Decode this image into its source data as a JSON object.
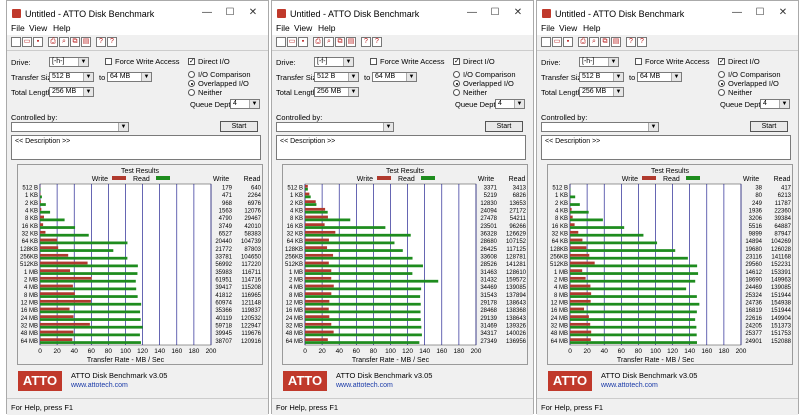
{
  "windows": [
    {
      "title": "Untitled - ATTO Disk Benchmark",
      "drive": "[-h-]",
      "ts_from": "512 B",
      "ts_to": "64 MB",
      "total_length": "256 MB",
      "queue_depth": "4",
      "write": [
        179,
        471,
        968,
        1563,
        4790,
        3749,
        6527,
        20440,
        21772,
        33781,
        56992,
        35983,
        61951,
        39417,
        41812,
        60974,
        35366,
        40119,
        59718,
        39945,
        38707
      ],
      "read": [
        640,
        2264,
        6976,
        12076,
        29467,
        42010,
        58383,
        104739,
        87803,
        104650,
        117220,
        116711,
        114716,
        115208,
        116965,
        121148,
        119837,
        120532,
        122947,
        119676,
        120916
      ]
    },
    {
      "title": "Untitled - ATTO Disk Benchmark",
      "drive": "[-f-]",
      "ts_from": "512 B",
      "ts_to": "64 MB",
      "total_length": "256 MB",
      "queue_depth": "4",
      "write": [
        3371,
        5219,
        12830,
        24094,
        27478,
        23501,
        36328,
        28680,
        26425,
        33608,
        28526,
        31463,
        31432,
        34469,
        31543,
        29178,
        28468,
        29139,
        31469,
        34317,
        27349
      ],
      "read": [
        3413,
        6826,
        13653,
        27172,
        54211,
        96266,
        126629,
        107152,
        117125,
        128781,
        141281,
        128610,
        159572,
        139085,
        137894,
        138643,
        138368,
        138643,
        139326,
        140026,
        136956
      ]
    },
    {
      "title": "Untitled - ATTO Disk Benchmark",
      "drive": "[-h-]",
      "ts_from": "512 B",
      "ts_to": "64 MB",
      "total_length": "256 MB",
      "queue_depth": "4",
      "write": [
        38,
        80,
        249,
        1936,
        3206,
        5516,
        9899,
        14894,
        19680,
        23116,
        29560,
        14612,
        18690,
        24469,
        25324,
        24736,
        16819,
        22616,
        24205,
        25377,
        24901
      ],
      "read": [
        417,
        6213,
        11787,
        22360,
        39384,
        64887,
        87947,
        104269,
        126028,
        141168,
        152231,
        153391,
        149963,
        139085,
        151944,
        154938,
        151944,
        149904,
        151373,
        151753,
        152088
      ]
    }
  ],
  "labels": {
    "menu": [
      "File",
      "View",
      "Help"
    ],
    "drive": "Drive:",
    "transfer_size": "Transfer Size:",
    "to": "to",
    "total_length": "Total Length:",
    "force_write": "Force Write Access",
    "direct_io": "Direct I/O",
    "io_comparison": "I/O Comparison",
    "overlapped_io": "Overlapped I/O",
    "neither": "Neither",
    "queue_depth": "Queue Depth:",
    "controlled_by": "Controlled by:",
    "start": "Start",
    "description": "<< Description >>",
    "test_results": "Test Results",
    "write": "Write",
    "read": "Read",
    "xlabel": "Transfer Rate - MB / Sec",
    "atto": "ATTO",
    "product": "ATTO Disk Benchmark v3.05",
    "url": "www.attotech.com",
    "status": "For Help, press F1"
  },
  "chart_data": [
    {
      "type": "bar",
      "title": "Test Results",
      "xlabel": "Transfer Rate - MB / Sec",
      "xlim": [
        0,
        200
      ],
      "categories": [
        "512 B",
        "1 KB",
        "2 KB",
        "4 KB",
        "8 KB",
        "16 KB",
        "32 KB",
        "64 KB",
        "128KB",
        "256KB",
        "512KB",
        "1 MB",
        "2 MB",
        "4 MB",
        "8 MB",
        "12 MB",
        "16 MB",
        "24 MB",
        "32 MB",
        "48 MB",
        "64 MB"
      ],
      "series": [
        {
          "name": "Write",
          "values": [
            179,
            471,
            968,
            1563,
            4790,
            3749,
            6527,
            20440,
            21772,
            33781,
            56992,
            35983,
            61951,
            39417,
            41812,
            60974,
            35366,
            40119,
            59718,
            39945,
            38707
          ]
        },
        {
          "name": "Read",
          "values": [
            640,
            2264,
            6976,
            12076,
            29467,
            42010,
            58383,
            104739,
            87803,
            104650,
            117220,
            116711,
            114716,
            115208,
            116965,
            121148,
            119837,
            120532,
            122947,
            119676,
            120916
          ]
        }
      ]
    },
    {
      "type": "bar",
      "title": "Test Results",
      "xlabel": "Transfer Rate - MB / Sec",
      "xlim": [
        0,
        200
      ],
      "categories": [
        "512 B",
        "1 KB",
        "2 KB",
        "4 KB",
        "8 KB",
        "16 KB",
        "32 KB",
        "64 KB",
        "128KB",
        "256KB",
        "512KB",
        "1 MB",
        "2 MB",
        "4 MB",
        "8 MB",
        "12 MB",
        "16 MB",
        "24 MB",
        "32 MB",
        "48 MB",
        "64 MB"
      ],
      "series": [
        {
          "name": "Write",
          "values": [
            3371,
            5219,
            12830,
            24094,
            27478,
            23501,
            36328,
            28680,
            26425,
            33608,
            28526,
            31463,
            31432,
            34469,
            31543,
            29178,
            28468,
            29139,
            31469,
            34317,
            27349
          ]
        },
        {
          "name": "Read",
          "values": [
            3413,
            6826,
            13653,
            27172,
            54211,
            96266,
            126629,
            107152,
            117125,
            128781,
            141281,
            128610,
            159572,
            139085,
            137894,
            138643,
            138368,
            138643,
            139326,
            140026,
            136956
          ]
        }
      ]
    },
    {
      "type": "bar",
      "title": "Test Results",
      "xlabel": "Transfer Rate - MB / Sec",
      "xlim": [
        0,
        200
      ],
      "categories": [
        "512 B",
        "1 KB",
        "2 KB",
        "4 KB",
        "8 KB",
        "16 KB",
        "32 KB",
        "64 KB",
        "128KB",
        "256KB",
        "512KB",
        "1 MB",
        "2 MB",
        "4 MB",
        "8 MB",
        "12 MB",
        "16 MB",
        "24 MB",
        "32 MB",
        "48 MB",
        "64 MB"
      ],
      "series": [
        {
          "name": "Write",
          "values": [
            38,
            80,
            249,
            1936,
            3206,
            5516,
            9899,
            14894,
            19680,
            23116,
            29560,
            14612,
            18690,
            24469,
            25324,
            24736,
            16819,
            22616,
            24205,
            25377,
            24901
          ]
        },
        {
          "name": "Read",
          "values": [
            417,
            6213,
            11787,
            22360,
            39384,
            64887,
            87947,
            104269,
            126028,
            141168,
            152231,
            153391,
            149963,
            139085,
            151944,
            154938,
            151944,
            149904,
            151373,
            151753,
            152088
          ]
        }
      ]
    }
  ],
  "colors": {
    "write": "#b03a2e",
    "read": "#1e8c1e",
    "atto_red": "#c0392b",
    "grid": "#000080"
  }
}
